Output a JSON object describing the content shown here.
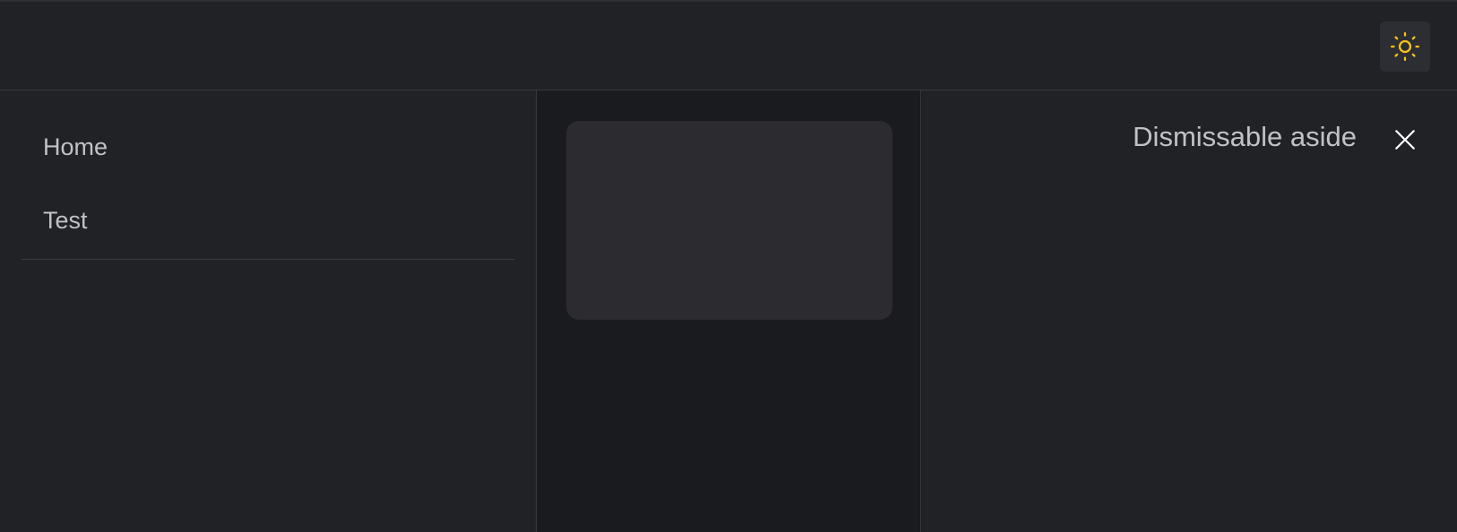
{
  "header": {
    "theme_toggle": {
      "icon": "sun-icon",
      "icon_color": "#fcc419"
    }
  },
  "navbar": {
    "items": [
      {
        "label": "Home"
      },
      {
        "label": "Test"
      }
    ]
  },
  "aside": {
    "title": "Dismissable aside",
    "close_icon": "close-icon"
  },
  "colors": {
    "background": "#1a1b1e",
    "panel": "#202226",
    "card": "#2c2b30",
    "border": "#373a40",
    "text": "#c1c2c5"
  }
}
